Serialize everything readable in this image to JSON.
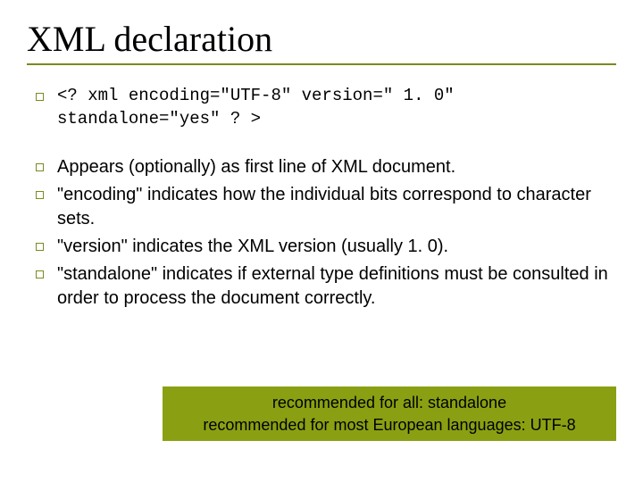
{
  "title": "XML declaration",
  "bullets": {
    "code": "<? xml encoding=\"UTF-8\" version=\" 1. 0\" standalone=\"yes\" ? >",
    "items": [
      "Appears (optionally) as first line of XML document.",
      "\"encoding\" indicates how the individual bits correspond to character sets.",
      "\"version\" indicates the XML version (usually 1. 0).",
      "\"standalone\" indicates if external type definitions must be consulted in order to process the document correctly."
    ]
  },
  "callout": {
    "line1": "recommended for all: standalone",
    "line2": "recommended for most European languages: UTF-8"
  }
}
